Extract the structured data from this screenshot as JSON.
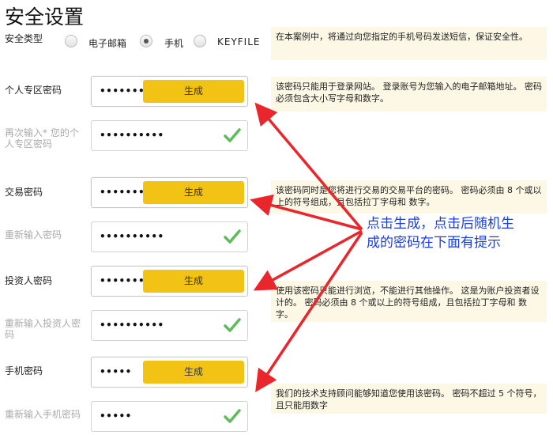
{
  "page": {
    "title": "安全设置"
  },
  "security_type": {
    "label": "安全类型",
    "options": [
      {
        "label": "电子邮箱",
        "selected": false
      },
      {
        "label": "手机",
        "selected": true
      },
      {
        "label": "KEYFILE",
        "selected": false
      }
    ]
  },
  "notes": {
    "security_type": "在本案例中，将通过向您指定的手机号码发送短信，保证安全性。",
    "personal": "该密码只能用于登录网站。 登录账号为您输入的电子邮箱地址。 密码必须包含大小写字母和数字。",
    "trading": "该密码同时是您将进行交易的交易平台的密码。 密码必须由 8 个或以上的符号组成，且包括拉丁字母和 数字。",
    "investor": "使用该密码只能进行浏览，不能进行其他操作。 这是为账户投资者设计的。 密码必须由 8 个或以上的符号组成，且包括拉丁字母和 数字。",
    "phone": "我们的技术支持顾问能够知道您使用该密码。 密码不超过 5 个符号，且只能用数字"
  },
  "fields": {
    "personal": {
      "label": "个人专区密码",
      "value": "••••••••••",
      "button": "生成"
    },
    "personal_confirm": {
      "label": "再次输入* 您的个人专区密码",
      "value": "••••••••••"
    },
    "trading": {
      "label": "交易密码",
      "value": "••••••••••",
      "button": "生成"
    },
    "trading_confirm": {
      "label": "重新输入密码",
      "value": "••••••••••"
    },
    "investor": {
      "label": "投资人密码",
      "value": "••••••••••",
      "button": "生成"
    },
    "investor_confirm": {
      "label": "重新输入投资人密码",
      "value": "••••••••••"
    },
    "phone": {
      "label": "手机密码",
      "value": "•••••",
      "button": "生成"
    },
    "phone_confirm": {
      "label": "重新输入手机密码",
      "value": "•••••"
    }
  },
  "annotation": {
    "line1": "点击生成，点击后随机生",
    "line2": "成的密码在下面有提示"
  },
  "colors": {
    "button": "#f2c315",
    "check": "#5cbd5a",
    "arrow": "#e8262b",
    "annotation": "#1a3fe0",
    "note_bg": "#fdf8e6"
  }
}
